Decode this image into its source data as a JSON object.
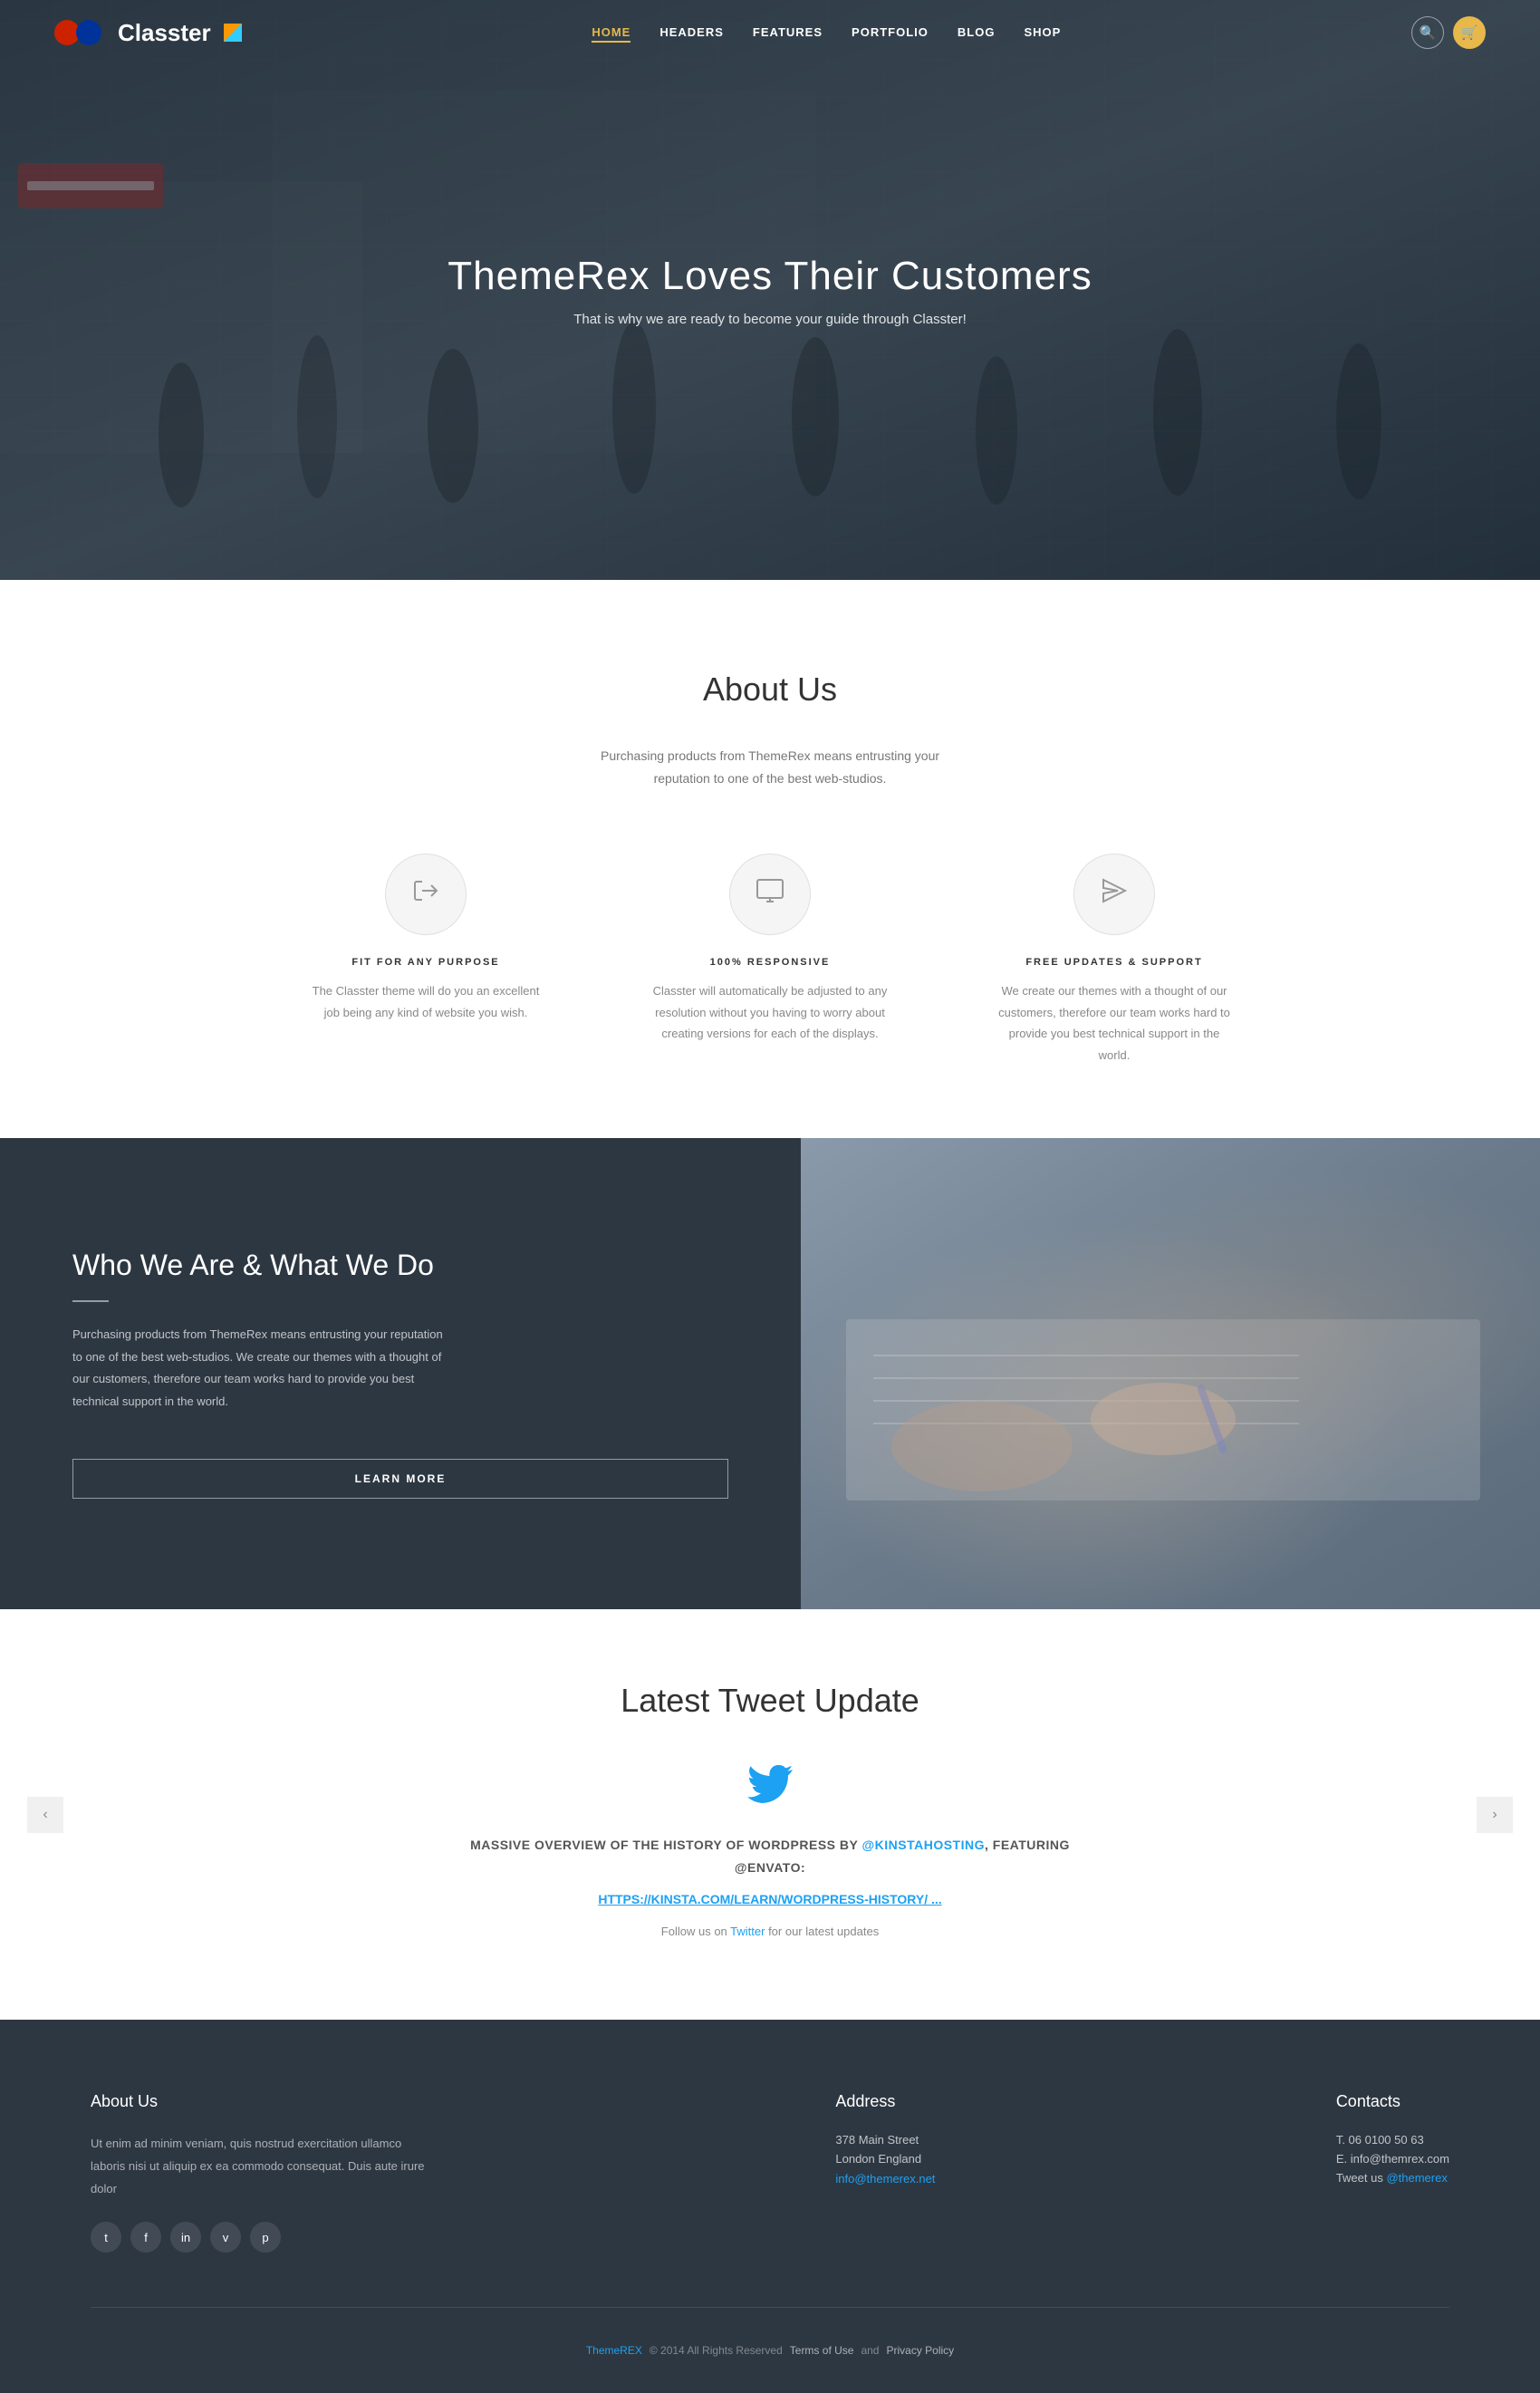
{
  "nav": {
    "logo_text": "Classter",
    "links": [
      {
        "label": "HOME",
        "active": true
      },
      {
        "label": "HEADERS",
        "active": false
      },
      {
        "label": "FEATURES",
        "active": false
      },
      {
        "label": "PORTFOLIO",
        "active": false
      },
      {
        "label": "BLOG",
        "active": false
      },
      {
        "label": "SHOP",
        "active": false
      }
    ],
    "search_icon": "🔍",
    "cart_icon": "🛒"
  },
  "hero": {
    "title": "ThemeRex Loves Their Customers",
    "subtitle": "That is why we are ready to become your guide through Classter!"
  },
  "about": {
    "title": "About Us",
    "desc": "Purchasing products from ThemeRex means entrusting your reputation to one of the best web-studios.",
    "features": [
      {
        "icon": "➡",
        "title": "FIT FOR ANY PURPOSE",
        "desc": "The Classter theme will do you an excellent job being any kind of website you wish."
      },
      {
        "icon": "🖥",
        "title": "100% RESPONSIVE",
        "desc": "Classter will automatically be adjusted to any resolution without you having to worry about creating versions for each of the displays."
      },
      {
        "icon": "✉",
        "title": "FREE UPDATES & SUPPORT",
        "desc": "We create our themes with a thought of our customers, therefore our team works hard to provide you best technical support in the world."
      }
    ]
  },
  "who": {
    "title": "Who We Are & What We Do",
    "desc": "Purchasing products from ThemeRex means entrusting your reputation to one of the best web-studios. We create our themes with a thought of our customers, therefore our team works hard to provide you best technical support in the world.",
    "button_label": "LEARN MORE"
  },
  "tweet": {
    "section_title": "Latest Tweet Update",
    "tweet_text_prefix": "MASSIVE OVERVIEW OF THE HISTORY OF WORDPRESS BY ",
    "tweet_handle": "@KINSTAHOSTING",
    "tweet_text_suffix": ", FEATURING @ENVATO:",
    "tweet_link": "HTTPS://KINSTA.COM/LEARN/WORDPRESS-HISTORY/ ...",
    "follow_prefix": "Follow us on ",
    "follow_link_text": "Twitter",
    "follow_suffix": " for our latest updates",
    "prev_icon": "‹",
    "next_icon": "›"
  },
  "footer": {
    "about_title": "About Us",
    "about_text": "Ut enim ad minim veniam, quis nostrud exercitation ullamco laboris nisi ut aliquip ex ea commodo consequat. Duis aute irure dolor",
    "social": [
      {
        "icon": "t",
        "label": "twitter"
      },
      {
        "icon": "f",
        "label": "facebook"
      },
      {
        "icon": "in",
        "label": "linkedin"
      },
      {
        "icon": "v",
        "label": "vimeo"
      },
      {
        "icon": "p",
        "label": "pinterest"
      }
    ],
    "address_title": "Address",
    "address_line1": "378 Main Street",
    "address_line2": "London England",
    "address_email": "info@themerex.net",
    "contacts_title": "Contacts",
    "phone": "T. 06 0100 50 63",
    "email": "E. info@themrex.com",
    "tweet_us": "Tweet us @themerex",
    "tweet_link": "@themerex",
    "copyright": "© 2014 All Rights Reserved",
    "brand": "ThemeREX",
    "terms": "Terms of Use",
    "privacy": "Privacy Policy",
    "and": "and"
  },
  "colors": {
    "accent": "#1da1f2",
    "gold": "#e8b84b",
    "dark": "#2d3742",
    "light_text": "#888888"
  }
}
